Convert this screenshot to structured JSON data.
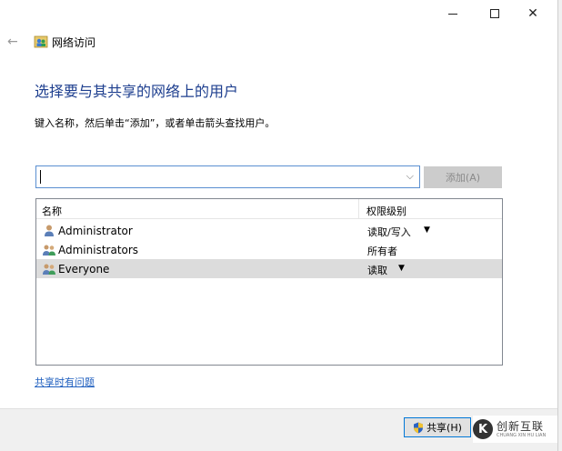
{
  "window": {
    "minimize_label": "",
    "maximize_label": "",
    "close_label": "✕"
  },
  "header": {
    "back_arrow": "←",
    "title": "网络访问"
  },
  "main": {
    "heading": "选择要与其共享的网络上的用户",
    "instruction": "键入名称，然后单击“添加”，或者单击箭头查找用户。",
    "combo": {
      "value": "",
      "arrow": "⌵"
    },
    "add_button": "添加(A)"
  },
  "list": {
    "columns": {
      "name": "名称",
      "permission": "权限级别"
    },
    "rows": [
      {
        "name": "Administrator",
        "permission": "读取/写入",
        "has_dropdown": true,
        "icon": "user-icon",
        "selected": false
      },
      {
        "name": "Administrators",
        "permission": "所有者",
        "has_dropdown": false,
        "icon": "group-icon",
        "selected": false
      },
      {
        "name": "Everyone",
        "permission": "读取",
        "has_dropdown": true,
        "icon": "group-icon",
        "selected": true
      }
    ],
    "dropdown_glyph": "▼"
  },
  "help_link": "共享时有问题",
  "footer": {
    "share_button": "共享(H)"
  },
  "watermark": {
    "logo": "K",
    "main": "创新互联",
    "sub": "CHUANG XIN HU LIAN"
  },
  "colors": {
    "heading": "#1e3f8f",
    "link": "#1f5fbf",
    "selected_row": "#dcdcdc",
    "footer_bg": "#f0f0f0",
    "focus_border": "#0078d7"
  }
}
